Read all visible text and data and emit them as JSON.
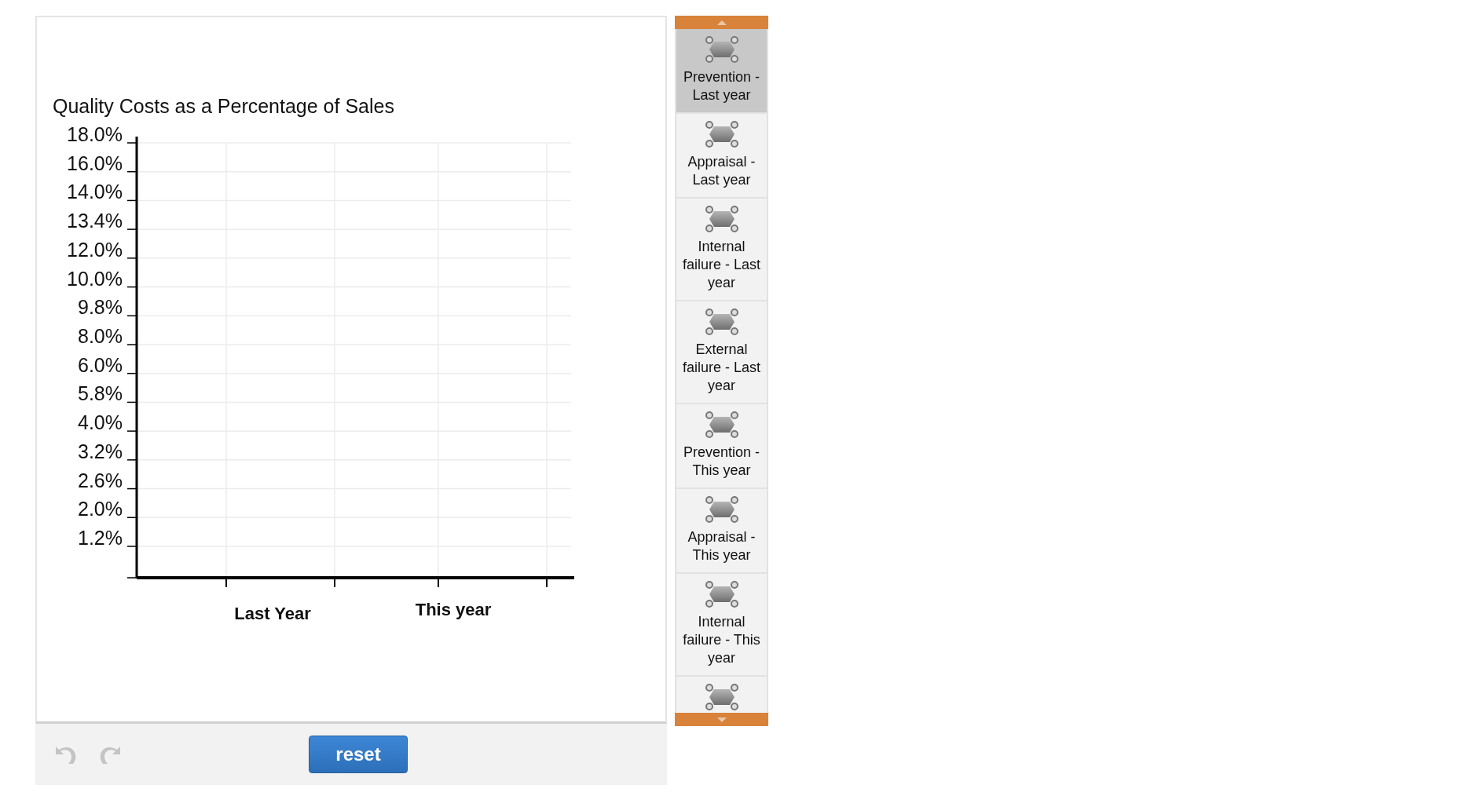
{
  "chart": {
    "title": "Quality Costs as a Percentage of Sales",
    "y_axis_labels": [
      "18.0%",
      "16.0%",
      "14.0%",
      "13.4%",
      "12.0%",
      "10.0%",
      "9.8%",
      "8.0%",
      "6.0%",
      "5.8%",
      "4.0%",
      "3.2%",
      "2.6%",
      "2.0%",
      "1.2%"
    ],
    "x_axis_labels": [
      "Last Year",
      "This year"
    ]
  },
  "toolbar": {
    "undo": {
      "disabled": true
    },
    "redo": {
      "disabled": true
    },
    "reset_button": "reset"
  },
  "palette": {
    "items": [
      {
        "label": "Prevention - Last year",
        "selected": true
      },
      {
        "label": "Appraisal - Last year",
        "selected": false
      },
      {
        "label": "Internal failure - Last year",
        "selected": false
      },
      {
        "label": "External failure - Last year",
        "selected": false
      },
      {
        "label": "Prevention - This year",
        "selected": false
      },
      {
        "label": "Appraisal - This year",
        "selected": false
      },
      {
        "label": "Internal failure - This year",
        "selected": false
      },
      {
        "selected": false
      }
    ]
  }
}
